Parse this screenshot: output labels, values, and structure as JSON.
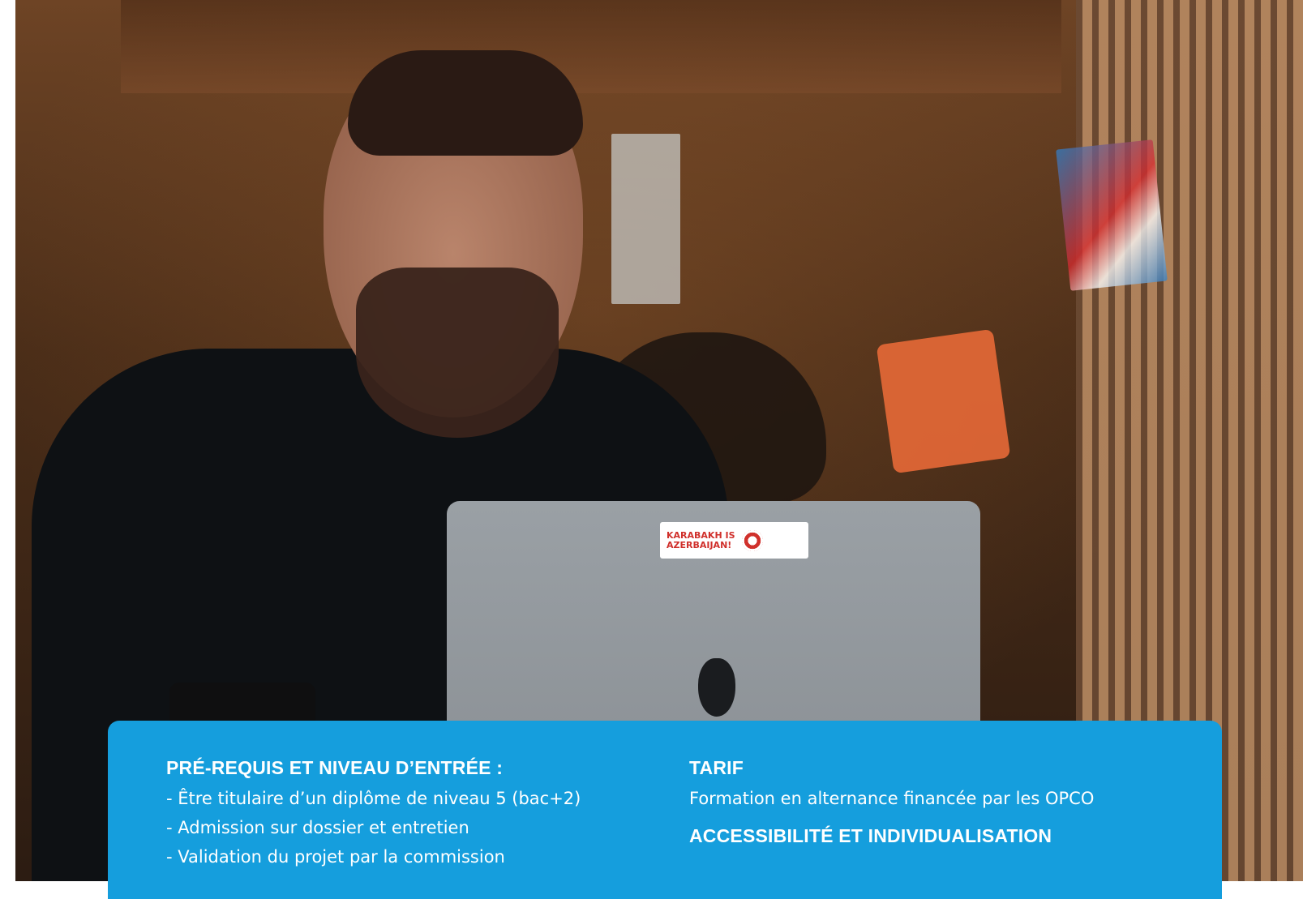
{
  "photo": {
    "laptop_sticker": "KARABAKH IS\nAZERBAIJAN!"
  },
  "info_card": {
    "left": {
      "heading": "PRÉ-REQUIS ET NIVEAU D’ENTRÉE :",
      "items": [
        "- Être titulaire d’un diplôme de niveau 5 (bac+2)",
        "- Admission sur dossier et entretien",
        "- Validation du projet par la commission"
      ]
    },
    "right": {
      "tarif_heading": "TARIF",
      "tarif_text": "Formation en alternance financée par les OPCO",
      "access_heading": "ACCESSIBILITÉ ET INDIVIDUALISATION"
    },
    "color": "#159edd"
  }
}
